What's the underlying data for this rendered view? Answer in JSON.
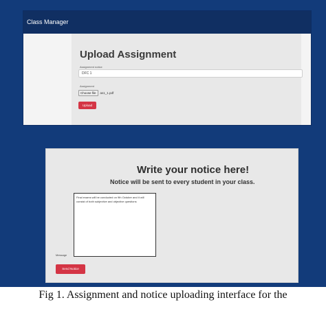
{
  "app": {
    "title": "Class Manager"
  },
  "upload": {
    "title": "Upload Assignment",
    "notice_label": "Assignment notice",
    "notice_value": "DFC 1",
    "file_label": "Assignment",
    "choose_file_label": "Choose file",
    "file_name": "as1_1.pdf",
    "upload_button": "Upload"
  },
  "notice": {
    "heading": "Write your notice here!",
    "subheading": "Notice will be sent to every student in your class.",
    "message_label": "Message",
    "message_text": "Final exams will be conducted on 9th October and it will consist of both subjective and objective questions",
    "send_button": "Send Notice"
  },
  "caption": {
    "line1": "Fig 1. Assignment and notice uploading interface for the"
  },
  "colors": {
    "background": "#123b7a",
    "navbar": "#102f62",
    "button": "#d43545"
  }
}
